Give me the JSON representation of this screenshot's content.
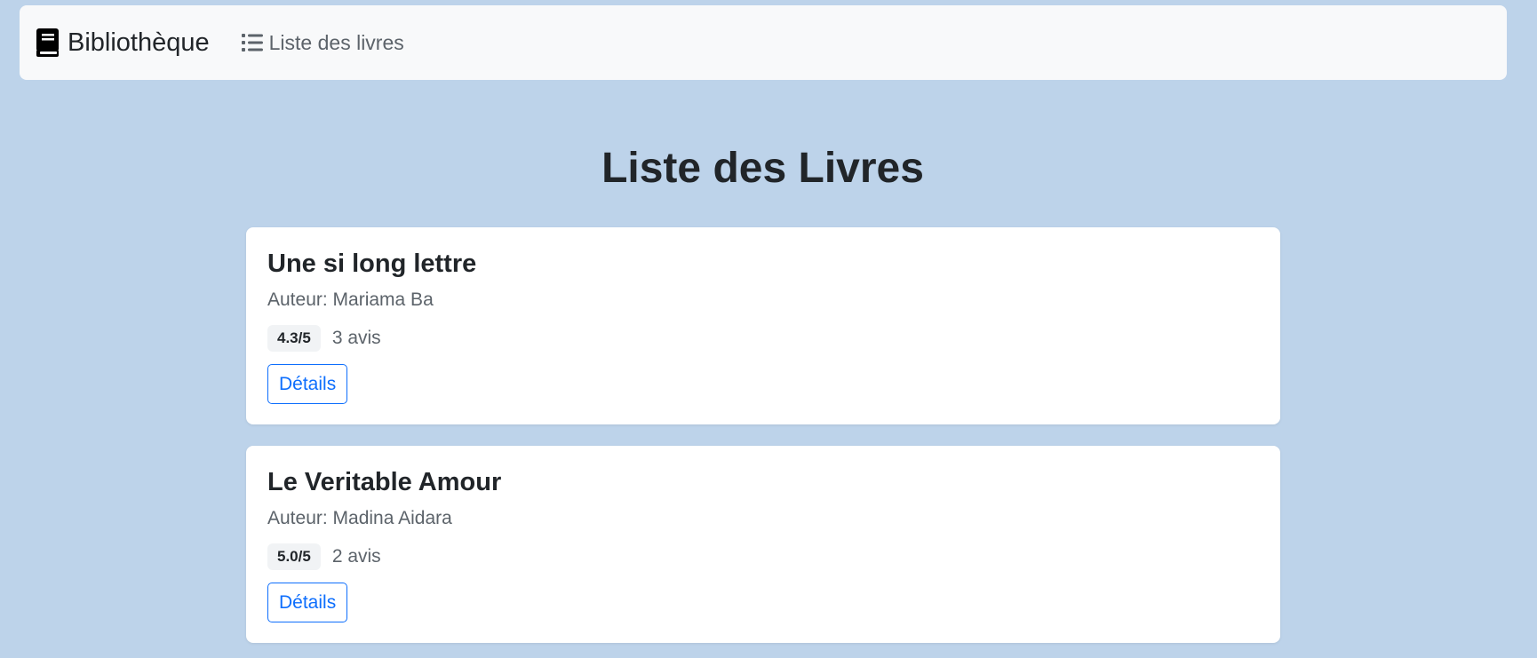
{
  "navbar": {
    "brand_label": "Bibliothèque",
    "brand_icon": "book-icon",
    "nav_link_label": "Liste des livres",
    "nav_link_icon": "list-icon"
  },
  "page": {
    "title": "Liste des Livres"
  },
  "books": [
    {
      "title": "Une si long lettre",
      "author": "Auteur: Mariama Ba",
      "rating": "4.3/5",
      "reviews": "3 avis",
      "details_label": "Détails"
    },
    {
      "title": "Le Veritable Amour",
      "author": "Auteur: Madina Aidara",
      "rating": "5.0/5",
      "reviews": "2 avis",
      "details_label": "Détails"
    }
  ],
  "colors": {
    "background": "#bdd3ea",
    "navbar": "#f8f9fa",
    "primary": "#0d6efd",
    "text": "#212529",
    "muted": "#5c636a"
  }
}
